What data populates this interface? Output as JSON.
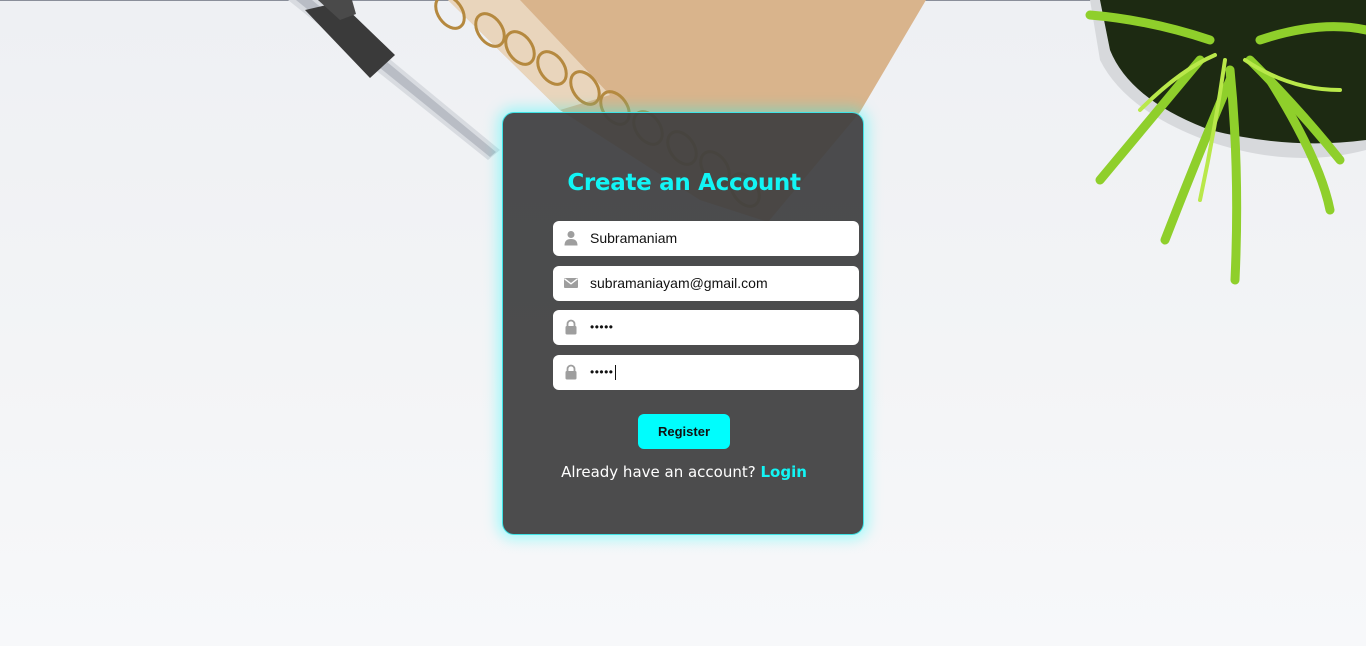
{
  "form": {
    "title": "Create an Account",
    "fields": [
      {
        "name": "username",
        "icon": "user-icon",
        "value": "Subramaniam"
      },
      {
        "name": "email",
        "icon": "envelope-icon",
        "value": "subramaniayam@gmail.com"
      },
      {
        "name": "password",
        "icon": "lock-icon",
        "value": "•••••"
      },
      {
        "name": "confirm_password",
        "icon": "lock-icon",
        "value": "•••••"
      }
    ],
    "register_label": "Register",
    "footer_prompt": "Already have an account?",
    "login_label": "Login"
  },
  "colors": {
    "accent": "#00FFFF",
    "card_background": "#3E3E40",
    "icon_gray": "#9E9E9E"
  }
}
